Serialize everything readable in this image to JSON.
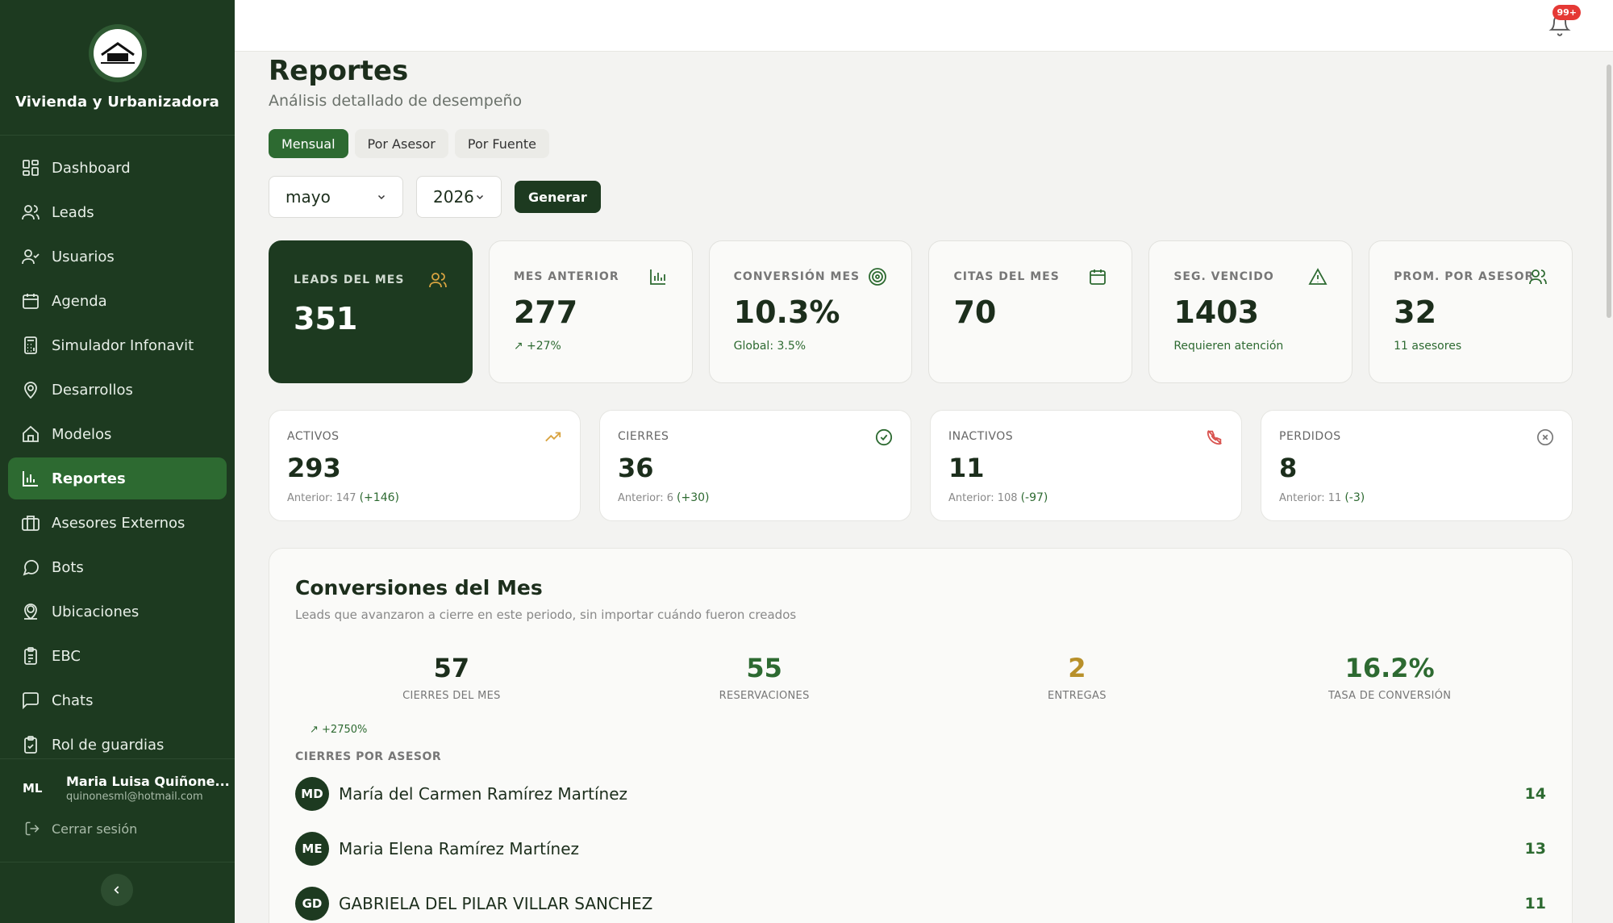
{
  "sidebar": {
    "brand": "Vivienda y Urbanizadora",
    "items": [
      {
        "label": "Dashboard",
        "icon": "dashboard-icon"
      },
      {
        "label": "Leads",
        "icon": "users-icon"
      },
      {
        "label": "Usuarios",
        "icon": "user-check-icon"
      },
      {
        "label": "Agenda",
        "icon": "calendar-icon"
      },
      {
        "label": "Simulador Infonavit",
        "icon": "calculator-icon"
      },
      {
        "label": "Desarrollos",
        "icon": "map-pin-icon"
      },
      {
        "label": "Modelos",
        "icon": "home-icon"
      },
      {
        "label": "Reportes",
        "icon": "bar-chart-icon",
        "active": true
      },
      {
        "label": "Asesores Externos",
        "icon": "briefcase-icon"
      },
      {
        "label": "Bots",
        "icon": "chat-bubble-icon"
      },
      {
        "label": "Ubicaciones",
        "icon": "location-user-icon"
      },
      {
        "label": "EBC",
        "icon": "clipboard-icon"
      },
      {
        "label": "Chats",
        "icon": "message-square-icon"
      },
      {
        "label": "Rol de guardias",
        "icon": "clipboard-check-icon"
      }
    ],
    "user": {
      "initials": "ML",
      "name": "Maria Luisa Quiñone...",
      "email": "quinonesml@hotmail.com"
    },
    "logout": "Cerrar sesión"
  },
  "topbar": {
    "notifications": "99+"
  },
  "page": {
    "title": "Reportes",
    "subtitle": "Análisis detallado de desempeño"
  },
  "tabs": [
    "Mensual",
    "Por Asesor",
    "Por Fuente"
  ],
  "filters": {
    "month": "mayo",
    "year": "2026",
    "generate": "Generar"
  },
  "kpis": [
    {
      "label": "LEADS DEL MES",
      "value": "351",
      "sub": ""
    },
    {
      "label": "MES ANTERIOR",
      "value": "277",
      "sub": "↗ +27%"
    },
    {
      "label": "CONVERSIÓN MES",
      "value": "10.3%",
      "sub": "Global: 3.5%"
    },
    {
      "label": "CITAS DEL MES",
      "value": "70",
      "sub": ""
    },
    {
      "label": "SEG. VENCIDO",
      "value": "1403",
      "sub": "Requieren atención"
    },
    {
      "label": "PROM. POR ASESOR",
      "value": "32",
      "sub": "11 asesores"
    }
  ],
  "stats": [
    {
      "label": "ACTIVOS",
      "value": "293",
      "prev": "Anterior: 147",
      "delta": "(+146)"
    },
    {
      "label": "CIERRES",
      "value": "36",
      "prev": "Anterior: 6",
      "delta": "(+30)"
    },
    {
      "label": "INACTIVOS",
      "value": "11",
      "prev": "Anterior: 108",
      "delta": "(-97)"
    },
    {
      "label": "PERDIDOS",
      "value": "8",
      "prev": "Anterior: 11",
      "delta": "(-3)"
    }
  ],
  "conversions": {
    "title": "Conversiones del Mes",
    "subtitle": "Leads que avanzaron a cierre en este periodo, sin importar cuándo fueron creados",
    "metrics": [
      {
        "value": "57",
        "label": "CIERRES DEL MES",
        "color": "#1c2e1c"
      },
      {
        "value": "55",
        "label": "RESERVACIONES",
        "color": "#2d6a31"
      },
      {
        "value": "2",
        "label": "ENTREGAS",
        "color": "#b8902a"
      },
      {
        "value": "16.2%",
        "label": "TASA DE CONVERSIÓN",
        "color": "#2d6a31"
      }
    ],
    "metric_delta": "↗ +2750%",
    "by_advisor_label": "CIERRES POR ASESOR",
    "advisors": [
      {
        "initials": "MD",
        "name": "María del Carmen Ramírez Martínez",
        "count": "14"
      },
      {
        "initials": "ME",
        "name": "Maria Elena Ramírez Martínez",
        "count": "13"
      },
      {
        "initials": "GD",
        "name": "GABRIELA DEL PILAR VILLAR SANCHEZ",
        "count": "11"
      }
    ]
  },
  "colors": {
    "sidebar": "#1d3a20",
    "accent": "#2d6a31",
    "gold": "#b8902a",
    "danger": "#e53935"
  }
}
